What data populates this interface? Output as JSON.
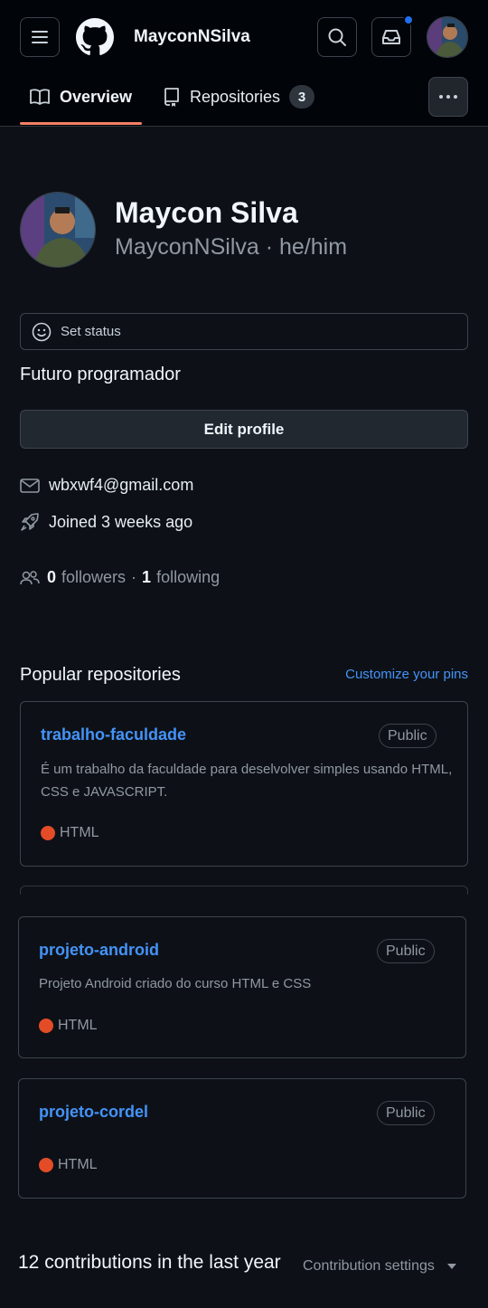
{
  "header": {
    "username": "MayconNSilva",
    "tabs": [
      {
        "label": "Overview"
      },
      {
        "label": "Repositories",
        "count": "3"
      }
    ]
  },
  "profile": {
    "full_name": "Maycon Silva",
    "login_line": "MayconNSilva · he/him",
    "status_label": "Set status",
    "bio": "Futuro programador",
    "edit_label": "Edit profile",
    "email": "wbxwf4@gmail.com",
    "joined": "Joined 3 weeks ago",
    "followers_count": "0",
    "followers_label": "followers",
    "separator": "·",
    "following_count": "1",
    "following_label": "following"
  },
  "popular": {
    "title": "Popular repositories",
    "customize_label": "Customize your pins",
    "repos": [
      {
        "name": "trabalho-faculdade",
        "badge": "Public",
        "description": "É um trabalho da faculdade para deselvolver simples usando HTML, CSS e JAVASCRIPT.",
        "language": "HTML"
      },
      {
        "name": "projeto-android",
        "badge": "Public",
        "description": "Projeto Android criado do curso HTML e CSS",
        "language": "HTML"
      },
      {
        "name": "projeto-cordel",
        "badge": "Public",
        "description": "",
        "language": "HTML"
      }
    ]
  },
  "contributions": {
    "summary": "12 contributions in the last year",
    "settings_label": "Contribution settings"
  },
  "colors": {
    "accent_link": "#4493f8",
    "tab_underline": "#f78166",
    "html_language": "#e34c26",
    "notification_dot": "#1f6feb"
  }
}
